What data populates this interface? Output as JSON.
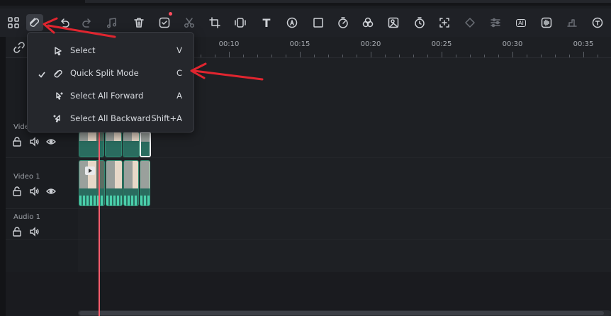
{
  "toolbar": {
    "icons": [
      "grid-icon",
      "split-mode-icon",
      "undo-icon",
      "redo-icon",
      "audio-note-icon",
      "delete-icon",
      "ai-tool-icon",
      "cut-icon",
      "crop-icon",
      "stabilize-icon",
      "text-icon",
      "ai-audio-icon",
      "shape-icon",
      "speed-icon",
      "color-icon",
      "ai-image-icon",
      "timer-icon",
      "add-frame-icon",
      "keyframe-icon",
      "adjust-icon",
      "ai-text-icon",
      "audio-wave-icon",
      "audio-duck-icon",
      "speech-text-icon"
    ],
    "ai_tag": "AI",
    "text_glyph": "T"
  },
  "ruler": {
    "labels": [
      "00:10",
      "00:15",
      "00:20",
      "00:25",
      "00:30",
      "00:35"
    ]
  },
  "tracks": {
    "video2_label": "Vide",
    "video1_label": "Video 1",
    "audio1_label": "Audio 1"
  },
  "menu": {
    "items": [
      {
        "label": "Select",
        "shortcut": "V",
        "checked": false,
        "icon": "cursor-icon"
      },
      {
        "label": "Quick Split Mode",
        "shortcut": "C",
        "checked": true,
        "icon": "split-mode-icon"
      },
      {
        "label": "Select All Forward",
        "shortcut": "A",
        "checked": false,
        "icon": "select-forward-icon"
      },
      {
        "label": "Select All Backward",
        "shortcut": "Shift+A",
        "checked": false,
        "icon": "select-backward-icon"
      }
    ]
  },
  "colors": {
    "accent_red": "#e0252f",
    "playhead": "#ff5c6c",
    "clip_green": "#2f8a71"
  }
}
